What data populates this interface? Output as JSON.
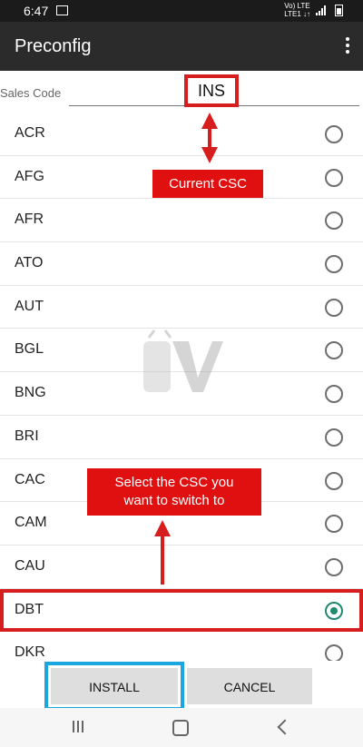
{
  "status_bar": {
    "time": "6:47",
    "network_top": "Vo) LTE",
    "network_bottom": "LTE1 ↓↑"
  },
  "app_bar": {
    "title": "Preconfig",
    "overflow_icon": "more-vert-icon"
  },
  "sales_code": {
    "label": "Sales Code",
    "value": "INS"
  },
  "annotations": {
    "current_csc": "Current CSC",
    "select_line1": "Select the CSC you",
    "select_line2": "want to switch to",
    "highlight_color": "#d71e1e",
    "button_highlight_color": "#1aa7e0"
  },
  "csc_list": [
    {
      "code": "ACR",
      "selected": false
    },
    {
      "code": "AFG",
      "selected": false
    },
    {
      "code": "AFR",
      "selected": false
    },
    {
      "code": "ATO",
      "selected": false
    },
    {
      "code": "AUT",
      "selected": false
    },
    {
      "code": "BGL",
      "selected": false
    },
    {
      "code": "BNG",
      "selected": false
    },
    {
      "code": "BRI",
      "selected": false
    },
    {
      "code": "CAC",
      "selected": false
    },
    {
      "code": "CAM",
      "selected": false
    },
    {
      "code": "CAU",
      "selected": false
    },
    {
      "code": "DBT",
      "selected": true
    },
    {
      "code": "DKR",
      "selected": false
    }
  ],
  "buttons": {
    "install": "INSTALL",
    "cancel": "CANCEL"
  },
  "nav": {
    "recents_icon": "recents-icon",
    "home_icon": "home-icon",
    "back_icon": "back-icon"
  }
}
